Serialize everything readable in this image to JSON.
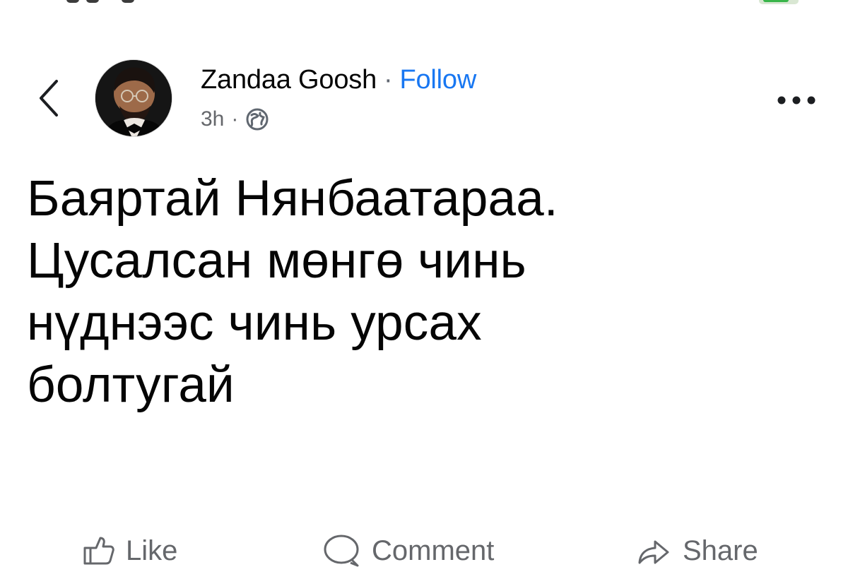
{
  "post": {
    "author": "Zandaa Goosh",
    "separator": "·",
    "follow_label": "Follow",
    "time": "3h",
    "meta_separator": "·",
    "audience_icon": "globe-icon",
    "text": "Баяртай Нянбаатараа.\nЦусалсан мөнгө чинь\nнүднээс чинь урсах\nболтугай"
  },
  "navigation": {
    "back_icon": "chevron-left-icon",
    "more_icon": "more-horizontal-icon"
  },
  "actions": [
    {
      "label": "Like",
      "icon": "thumbs-up-icon"
    },
    {
      "label": "Comment",
      "icon": "comment-icon"
    },
    {
      "label": "Share",
      "icon": "share-icon"
    }
  ],
  "colors": {
    "link": "#1877f2",
    "muted": "#65676b",
    "text": "#050505",
    "background": "#ffffff"
  }
}
